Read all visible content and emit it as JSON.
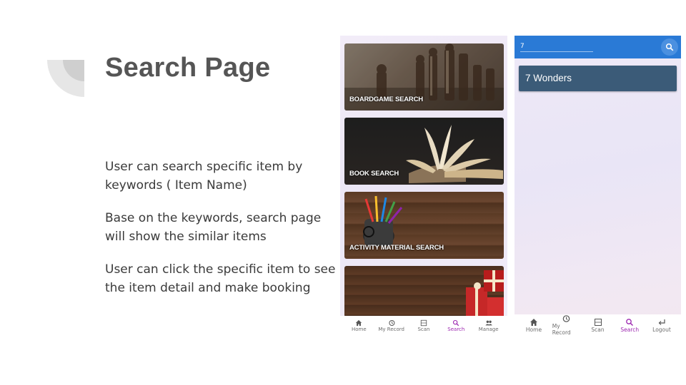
{
  "slide": {
    "title": "Search Page",
    "paragraphs": [
      "User can search specific item by keywords ( Item Name)",
      "Base on the keywords, search page will show the similar items",
      "User can click the specific item to see the item detail and make booking"
    ]
  },
  "phone_left": {
    "cards": [
      {
        "label": "BOARDGAME SEARCH"
      },
      {
        "label": "BOOK SEARCH"
      },
      {
        "label": "ACTIVITY MATERIAL SEARCH"
      },
      {
        "label": ""
      }
    ],
    "nav": [
      {
        "label": "Home",
        "icon": "home-icon",
        "active": false
      },
      {
        "label": "My Record",
        "icon": "history-icon",
        "active": false
      },
      {
        "label": "Scan",
        "icon": "scan-icon",
        "active": false
      },
      {
        "label": "Search",
        "icon": "search-icon",
        "active": true
      },
      {
        "label": "Manage",
        "icon": "people-icon",
        "active": false
      }
    ]
  },
  "phone_right": {
    "search": {
      "value": "7"
    },
    "results": [
      {
        "label": "7 Wonders"
      }
    ],
    "nav": [
      {
        "label": "Home",
        "icon": "home-icon",
        "active": false
      },
      {
        "label": "My Record",
        "icon": "history-icon",
        "active": false
      },
      {
        "label": "Scan",
        "icon": "scan-icon",
        "active": false
      },
      {
        "label": "Search",
        "icon": "search-icon",
        "active": true
      },
      {
        "label": "Logout",
        "icon": "logout-icon",
        "active": false
      }
    ]
  },
  "colors": {
    "appbar": "#2a7ad6",
    "result_item": "#3b5b78",
    "active_nav": "#9c27b0",
    "title": "#555555"
  }
}
